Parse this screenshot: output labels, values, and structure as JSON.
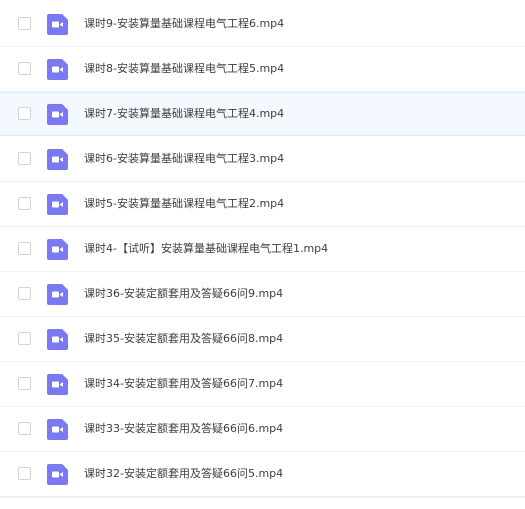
{
  "file_list": {
    "highlight_color": "#f3f9fe",
    "icon_color": "#7b79f1",
    "items": [
      {
        "name": "课时9-安装算量基础课程电气工程6.mp4",
        "type": "video"
      },
      {
        "name": "课时8-安装算量基础课程电气工程5.mp4",
        "type": "video"
      },
      {
        "name": "课时7-安装算量基础课程电气工程4.mp4",
        "type": "video"
      },
      {
        "name": "课时6-安装算量基础课程电气工程3.mp4",
        "type": "video"
      },
      {
        "name": "课时5-安装算量基础课程电气工程2.mp4",
        "type": "video"
      },
      {
        "name": "课时4-【试听】安装算量基础课程电气工程1.mp4",
        "type": "video"
      },
      {
        "name": "课时36-安装定额套用及答疑66问9.mp4",
        "type": "video"
      },
      {
        "name": "课时35-安装定额套用及答疑66问8.mp4",
        "type": "video"
      },
      {
        "name": "课时34-安装定额套用及答疑66问7.mp4",
        "type": "video"
      },
      {
        "name": "课时33-安装定额套用及答疑66问6.mp4",
        "type": "video"
      },
      {
        "name": "课时32-安装定额套用及答疑66问5.mp4",
        "type": "video"
      }
    ]
  }
}
